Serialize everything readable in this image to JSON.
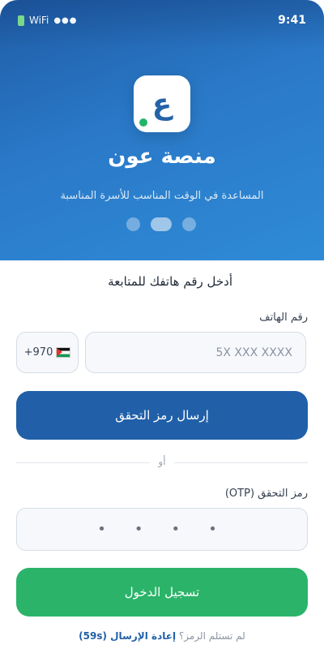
{
  "status_bar": {
    "network": "WiFi",
    "signal": "●●●",
    "time": "9:41"
  },
  "hero": {
    "logo_glyph": "ع",
    "title": "منصة عون",
    "subtitle": "المساعدة في الوقت المناسب للأسرة المناسبة",
    "pager": {
      "pages": 3,
      "active": 2
    }
  },
  "form": {
    "heading": "أدخل رقم هاتفك للمتابعة",
    "phone": {
      "label": "رقم الهاتف",
      "placeholder": "5X XXX XXXX",
      "country_code": "+970",
      "flag": "palestine-flag"
    },
    "send_button": "إرسال رمز التحقق",
    "divider_text": "أو",
    "otp": {
      "label": "رمز التحقق (OTP)",
      "placeholder": "• • • •"
    },
    "login_button": "تسجيل الدخول",
    "resend": {
      "prompt": "لم تستلم الرمز؟",
      "link": "إعادة الإرسال (59s)"
    }
  },
  "colors": {
    "primary": "#2160a8",
    "success": "#2bb469",
    "hero_gradient_start": "#1f5ca6",
    "hero_gradient_end": "#2f8bd6"
  }
}
